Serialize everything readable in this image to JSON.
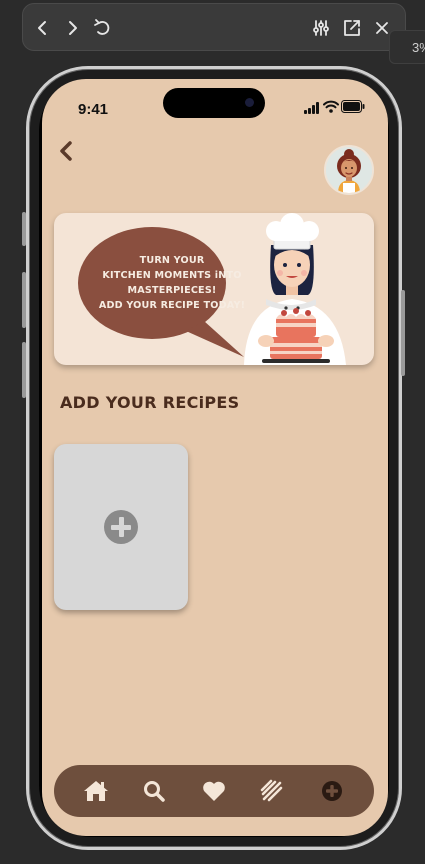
{
  "viewer": {
    "buttons": [
      "back-icon",
      "forward-icon",
      "undo-icon",
      "sliders-icon",
      "open-external-icon",
      "close-icon"
    ],
    "side_tab_text": "3%"
  },
  "status_bar": {
    "time": "9:41"
  },
  "banner": {
    "line1": "TURN YOUR",
    "line2": "KITCHEN MOMENTS iNTO",
    "line3": "MASTERPIECES!",
    "line4": "ADD YOUR RECIPE TODAY!"
  },
  "section": {
    "title": "ADD YOUR RECiPES"
  },
  "colors": {
    "background": "#e6c9ad",
    "bubble": "#8a4f3f",
    "navbar": "#6e4f3d",
    "title": "#4a2c1e",
    "card": "#d7d7d7"
  },
  "nav": {
    "items": [
      "home-icon",
      "search-icon",
      "heart-icon",
      "recipes-icon",
      "add-icon"
    ]
  }
}
